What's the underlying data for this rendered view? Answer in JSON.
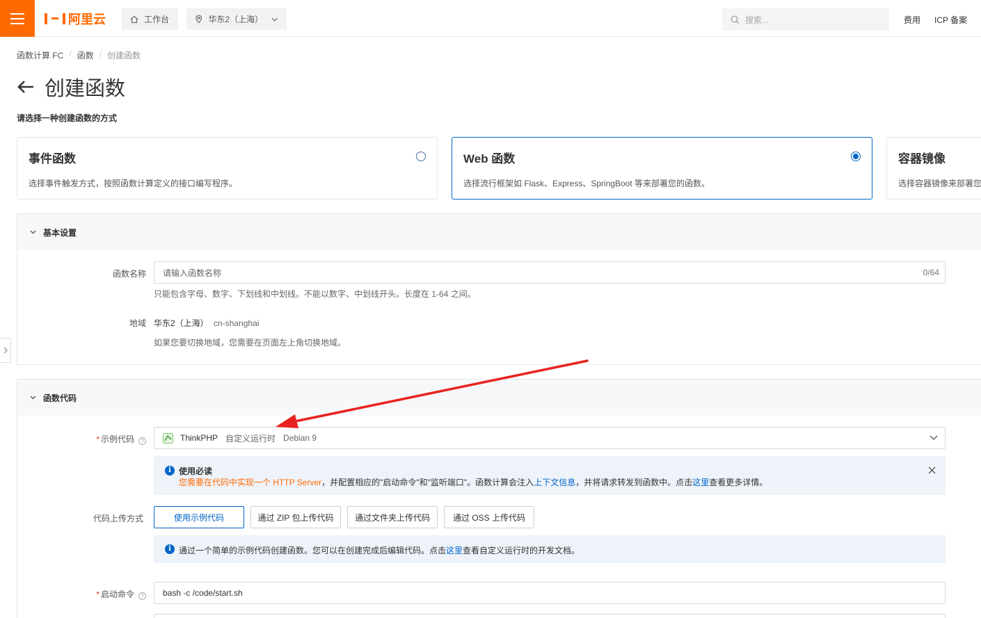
{
  "header": {
    "logo_text": "阿里云",
    "workbench_label": "工作台",
    "region_label": "华东2（上海）",
    "search_placeholder": "搜索...",
    "links": [
      "费用",
      "ICP 备案"
    ]
  },
  "breadcrumb": [
    "函数计算 FC",
    "函数",
    "创建函数"
  ],
  "page": {
    "title": "创建函数",
    "subtitle": "请选择一种创建函数的方式"
  },
  "function_types": [
    {
      "title": "事件函数",
      "desc": "选择事件触发方式，按照函数计算定义的接口编写程序。",
      "selected": false
    },
    {
      "title": "Web 函数",
      "desc": "选择流行框架如 Flask、Express、SpringBoot 等来部署您的函数。",
      "selected": true
    },
    {
      "title": "容器镜像",
      "desc": "选择容器镜像来部署您",
      "selected": false
    }
  ],
  "basic_settings": {
    "section_title": "基本设置",
    "name_label": "函数名称",
    "name_placeholder": "请输入函数名称",
    "name_count": "0/64",
    "name_hint": "只能包含字母、数字、下划线和中划线。不能以数字、中划线开头。长度在 1-64 之间。",
    "region_label": "地域",
    "region_value": "华东2（上海）",
    "region_code": "cn-shanghai",
    "region_hint": "如果您要切换地域，您需要在页面左上角切换地域。"
  },
  "function_code": {
    "section_title": "函数代码",
    "sample_label": "示例代码",
    "sample_name": "ThinkPHP",
    "sample_runtime": "自定义运行时",
    "sample_os": "Debian 9",
    "notice": {
      "title": "使用必读",
      "orange_text": "您需要在代码中实现一个 HTTP Server",
      "text_1": "，并配置相应的\"启动命令\"和\"监听端口\"。函数计算会注入",
      "link_1": "上下文信息",
      "text_2": "，并将请求转发到函数中。点击",
      "link_2": "这里",
      "text_3": "查看更多详情。"
    },
    "upload_label": "代码上传方式",
    "upload_options": [
      "使用示例代码",
      "通过 ZIP 包上传代码",
      "通过文件夹上传代码",
      "通过 OSS 上传代码"
    ],
    "upload_info": {
      "text_1": "通过一个简单的示例代码创建函数。您可以在创建完成后编辑代码。点击",
      "link": "这里",
      "text_2": "查看自定义运行时的开发文档。"
    },
    "start_cmd_label": "启动命令",
    "start_cmd_value": "bash -c /code/start.sh"
  },
  "colors": {
    "brand_orange": "#ff6a00",
    "primary_blue": "#0064c8",
    "annotation_red": "#e8231f"
  }
}
